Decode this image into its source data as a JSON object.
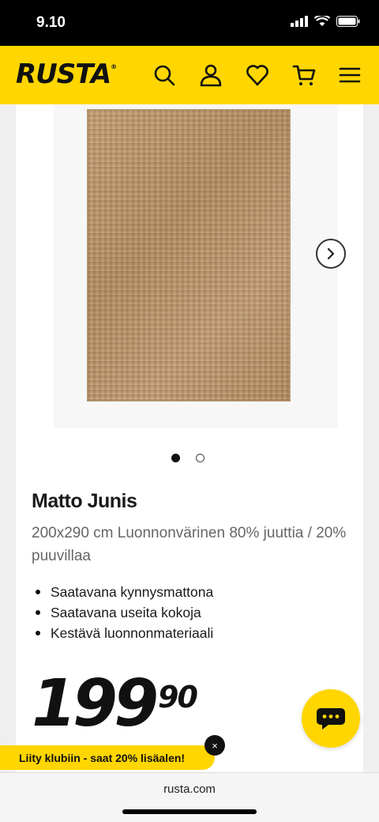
{
  "status_bar": {
    "time": "9.10"
  },
  "header": {
    "logo": "RUSTA",
    "icons": [
      "search-icon",
      "account-icon",
      "heart-icon",
      "cart-icon",
      "menu-icon"
    ]
  },
  "gallery": {
    "image_count": 2,
    "active_index": 0
  },
  "product": {
    "title": "Matto Junis",
    "subtitle": "200x290 cm Luonnonvärinen 80% juuttia / 20% puuvillaa",
    "features": [
      "Saatavana kynnysmattona",
      "Saatavana useita kokoja",
      "Kestävä luonnonmateriaali"
    ],
    "price_main": "199",
    "price_cents": "90"
  },
  "club_banner": {
    "text": "Liity klubiin - saat 20% lisäalen!",
    "close_symbol": "×"
  },
  "browser": {
    "url": "rusta.com"
  },
  "colors": {
    "brand_yellow": "#ffd600",
    "text_dark": "#111111",
    "text_muted": "#666666"
  }
}
